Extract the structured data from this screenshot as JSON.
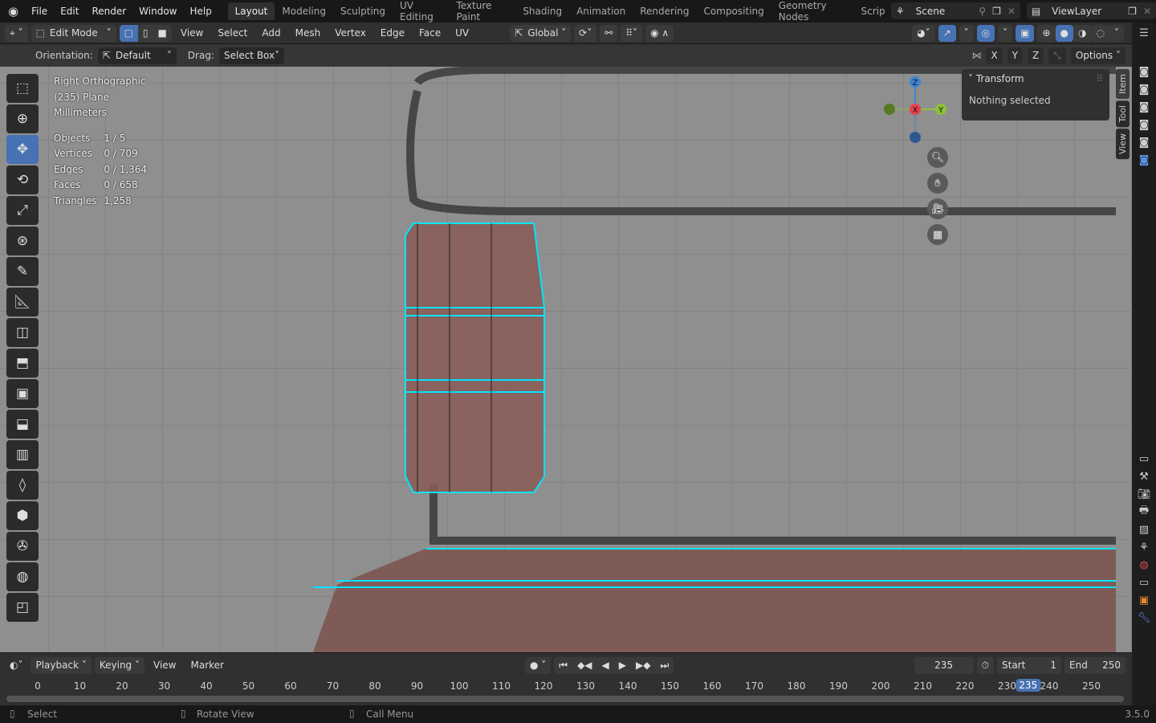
{
  "topbar": {
    "menus": [
      "File",
      "Edit",
      "Render",
      "Window",
      "Help"
    ],
    "workspaces": [
      "Layout",
      "Modeling",
      "Sculpting",
      "UV Editing",
      "Texture Paint",
      "Shading",
      "Animation",
      "Rendering",
      "Compositing",
      "Geometry Nodes",
      "Scripting"
    ],
    "active_workspace": "Layout",
    "scene": "Scene",
    "view_layer": "ViewLayer"
  },
  "header": {
    "mode": "Edit Mode",
    "menus": [
      "View",
      "Select",
      "Add",
      "Mesh",
      "Vertex",
      "Edge",
      "Face",
      "UV"
    ],
    "transform_orientation": "Global",
    "select_mode": "vertex"
  },
  "tool_settings": {
    "orientation_label": "Orientation:",
    "orientation": "Default",
    "drag_label": "Drag:",
    "drag": "Select Box",
    "axes": [
      "X",
      "Y",
      "Z"
    ],
    "options": "Options"
  },
  "overlay": {
    "view": "Right Orthographic",
    "object": "(235) Plane",
    "units": "Millimeters",
    "stats": [
      {
        "label": "Objects",
        "value": "1 / 5"
      },
      {
        "label": "Vertices",
        "value": "0 / 709"
      },
      {
        "label": "Edges",
        "value": "0 / 1,364"
      },
      {
        "label": "Faces",
        "value": "0 / 658"
      },
      {
        "label": "Triangles",
        "value": "1,258"
      }
    ]
  },
  "gizmo": {
    "z": "Z",
    "y": "Y",
    "x": "X",
    "colors": {
      "x": "#e8414d",
      "y": "#8bc13a",
      "z": "#3d84d6"
    }
  },
  "npanel": {
    "title": "Transform",
    "content": "Nothing selected",
    "tabs": [
      "Item",
      "Tool",
      "View"
    ]
  },
  "timeline": {
    "menus": [
      "Playback",
      "Keying",
      "View",
      "Marker"
    ],
    "current_frame": "235",
    "start_label": "Start",
    "start": "1",
    "end_label": "End",
    "end": "250",
    "ticks": [
      "0",
      "10",
      "20",
      "30",
      "40",
      "50",
      "60",
      "70",
      "80",
      "90",
      "100",
      "110",
      "120",
      "130",
      "140",
      "150",
      "160",
      "170",
      "180",
      "190",
      "200",
      "210",
      "220",
      "230",
      "240",
      "250"
    ],
    "playhead": "235"
  },
  "status": {
    "select": "Select",
    "rotate": "Rotate View",
    "menu": "Call Menu",
    "version": "3.5.0"
  },
  "colors": {
    "accent": "#4772b3",
    "mesh_edge": "#00e5ff",
    "mesh_face": "#8a5a56"
  }
}
